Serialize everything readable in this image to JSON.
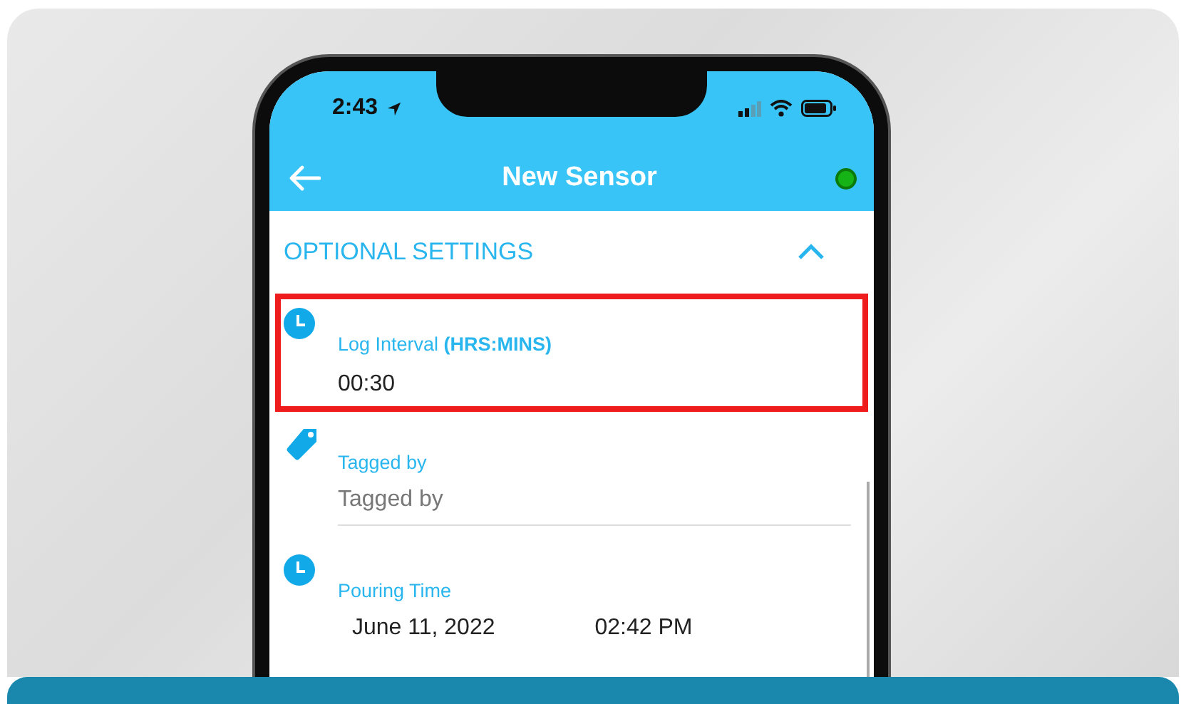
{
  "status_bar": {
    "time": "2:43"
  },
  "header": {
    "title": "New Sensor",
    "connected": true
  },
  "section": {
    "title": "OPTIONAL SETTINGS",
    "expanded": true
  },
  "fields": [
    {
      "kind": "value",
      "label": "Log Interval **(HRS:MINS)**",
      "value": "00:30",
      "highlighted": true
    },
    {
      "kind": "input",
      "label": "Tagged by",
      "placeholder": "Tagged by",
      "highlighted": false
    },
    {
      "kind": "datetime",
      "label": "Pouring Time",
      "date": "June 11, 2022",
      "time": "02:42 PM",
      "highlighted": false
    }
  ]
}
